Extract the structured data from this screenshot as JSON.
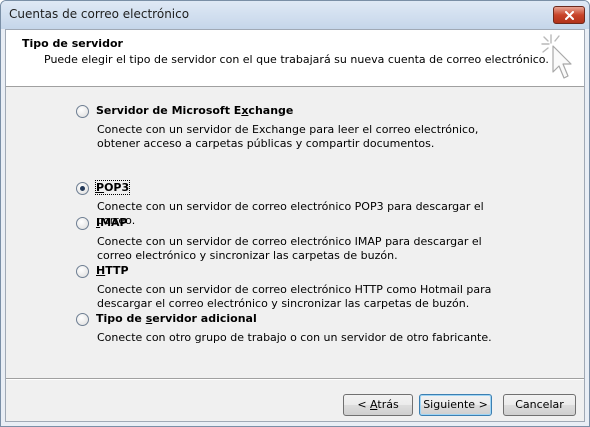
{
  "window": {
    "title": "Cuentas de correo electrónico"
  },
  "header": {
    "title": "Tipo de servidor",
    "subtitle": "Puede elegir el tipo de servidor con el que trabajará su nueva cuenta de correo electrónico."
  },
  "options": [
    {
      "label_pre": "Servidor de Microsoft E",
      "label_key": "x",
      "label_post": "change",
      "description": "Conecte con un servidor de Exchange para leer el correo electrónico, obtener acceso a carpetas públicas y compartir documentos.",
      "checked": false
    },
    {
      "label_pre": "",
      "label_key": "P",
      "label_post": "OP3",
      "description": "Conecte con un servidor de correo electrónico POP3 para descargar el correo.",
      "checked": true
    },
    {
      "label_pre": "",
      "label_key": "I",
      "label_post": "MAP",
      "description": "Conecte con un servidor de correo electrónico IMAP para descargar el correo electrónico y sincronizar las carpetas de buzón.",
      "checked": false
    },
    {
      "label_pre": "",
      "label_key": "H",
      "label_post": "TTP",
      "description": "Conecte con un servidor de correo electrónico HTTP como Hotmail para descargar el correo electrónico y sincronizar las carpetas de buzón.",
      "checked": false
    },
    {
      "label_pre": "Tipo de ",
      "label_key": "s",
      "label_post": "ervidor adicional",
      "description": "Conecte con otro grupo de trabajo o con un servidor de otro fabricante.",
      "checked": false
    }
  ],
  "buttons": {
    "back": {
      "pre": "< ",
      "key": "A",
      "post": "trás"
    },
    "next": {
      "label": "Siguiente >"
    },
    "cancel": {
      "label": "Cancelar"
    }
  }
}
